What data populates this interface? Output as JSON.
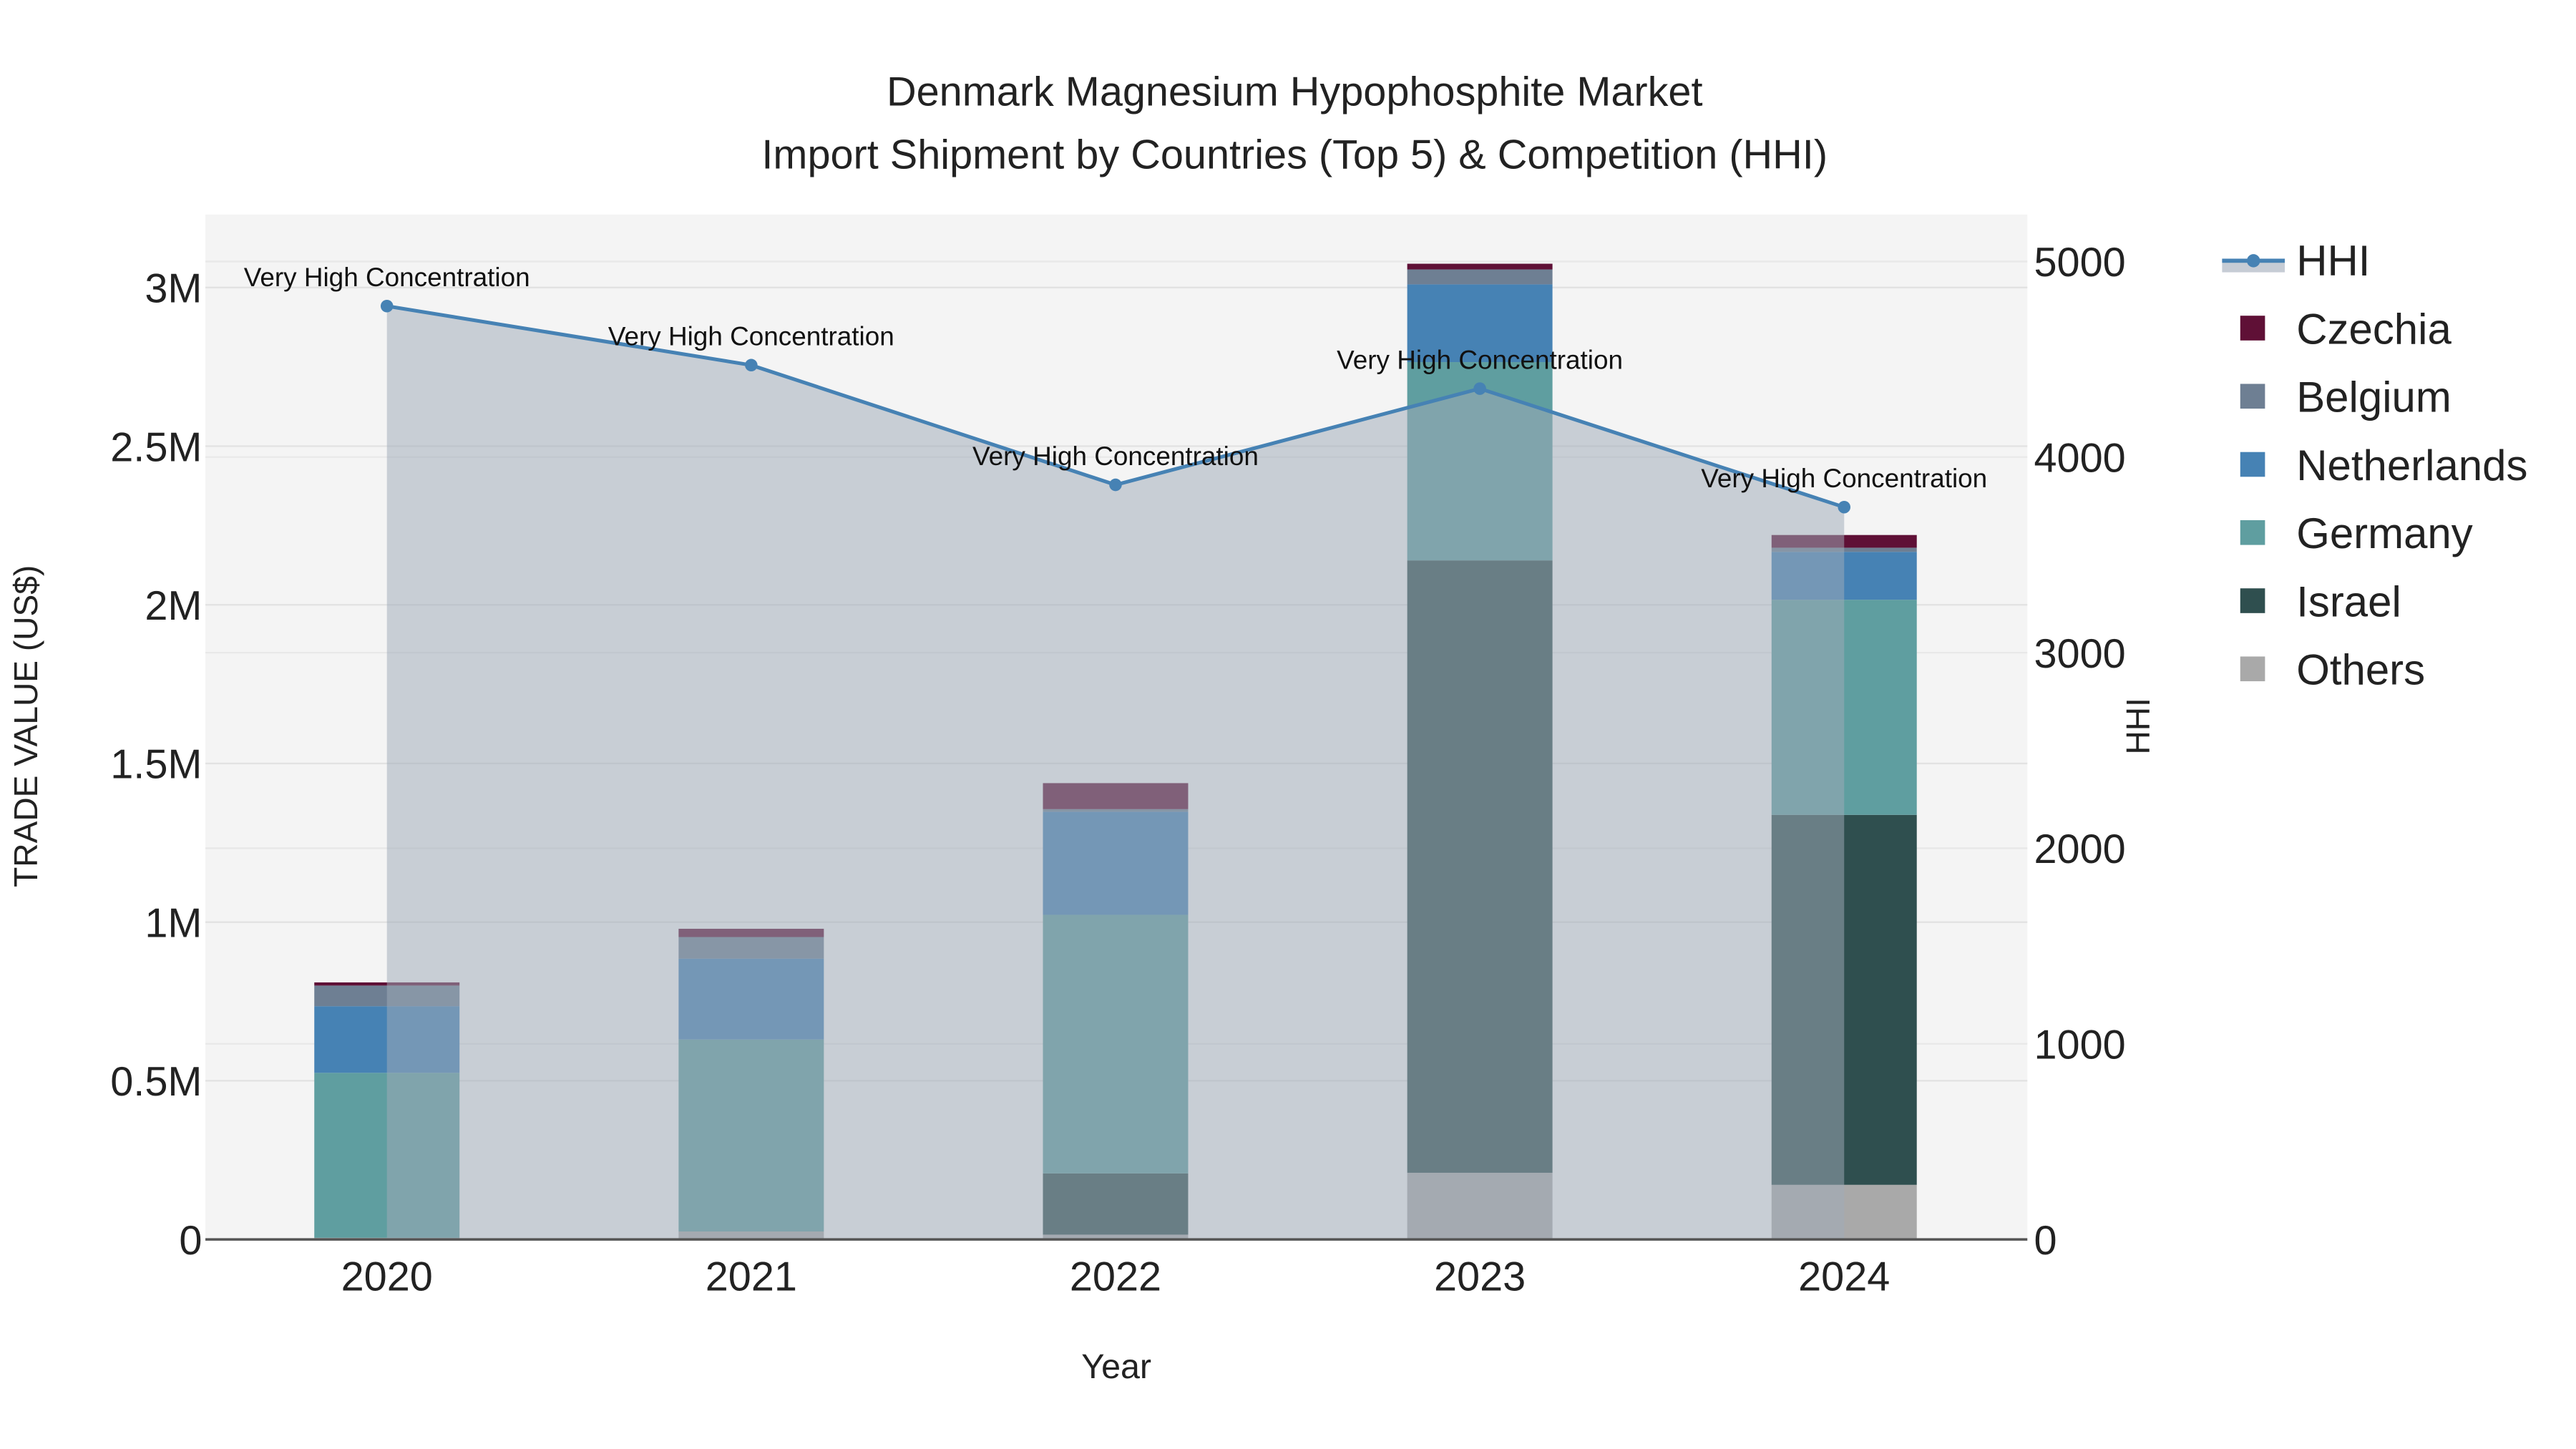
{
  "chart_data": {
    "type": "bar",
    "title_line1": "Denmark Magnesium Hypophosphite Market",
    "title_line2": "Import Shipment by Countries (Top 5) & Competition (HHI)",
    "xlabel": "Year",
    "ylabel": "TRADE VALUE (US$)",
    "y2label": "HHI",
    "categories": [
      "2020",
      "2021",
      "2022",
      "2023",
      "2024"
    ],
    "ylim": [
      0,
      3230000
    ],
    "y2lim": [
      0,
      5240
    ],
    "yticks": [
      {
        "v": 0,
        "label": "0"
      },
      {
        "v": 500000,
        "label": "0.5M"
      },
      {
        "v": 1000000,
        "label": "1M"
      },
      {
        "v": 1500000,
        "label": "1.5M"
      },
      {
        "v": 2000000,
        "label": "2M"
      },
      {
        "v": 2500000,
        "label": "2.5M"
      },
      {
        "v": 3000000,
        "label": "3M"
      }
    ],
    "y2ticks": [
      {
        "v": 0,
        "label": "0"
      },
      {
        "v": 1000,
        "label": "1000"
      },
      {
        "v": 2000,
        "label": "2000"
      },
      {
        "v": 3000,
        "label": "3000"
      },
      {
        "v": 4000,
        "label": "4000"
      },
      {
        "v": 5000,
        "label": "5000"
      }
    ],
    "series": [
      {
        "name": "Others",
        "color": "#a9a9a9",
        "values": [
          5000,
          25000,
          15000,
          210000,
          172000
        ]
      },
      {
        "name": "Israel",
        "color": "#2f4f4f",
        "values": [
          0,
          0,
          193000,
          1930000,
          1166000
        ]
      },
      {
        "name": "Germany",
        "color": "#5f9ea0",
        "values": [
          520000,
          605000,
          815000,
          625000,
          678000
        ]
      },
      {
        "name": "Netherlands",
        "color": "#4682b4",
        "values": [
          210000,
          255000,
          325000,
          245000,
          151000
        ]
      },
      {
        "name": "Belgium",
        "color": "#6e7f93",
        "values": [
          65000,
          68000,
          8000,
          47000,
          13000
        ]
      },
      {
        "name": "Czechia",
        "color": "#5f1036",
        "values": [
          10000,
          26000,
          82000,
          18000,
          40000
        ]
      }
    ],
    "hhi": {
      "name": "HHI",
      "color": "#4682b4",
      "values": [
        4772,
        4470,
        3858,
        4350,
        3744
      ],
      "annotations": [
        "Very High Concentration",
        "Very High Concentration",
        "Very High Concentration",
        "Very High Concentration",
        "Very High Concentration"
      ]
    },
    "legend": [
      "HHI",
      "Czechia",
      "Belgium",
      "Netherlands",
      "Germany",
      "Israel",
      "Others"
    ],
    "legend_position": "right",
    "grid": true
  }
}
